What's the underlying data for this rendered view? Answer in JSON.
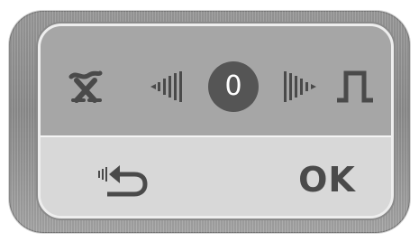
{
  "panel": {
    "top_row": {
      "left_icon": "x-tilde-icon",
      "decrease_icon": "volume-down-icon",
      "value": "0",
      "increase_icon": "volume-up-icon",
      "right_icon": "square-wave-icon"
    },
    "bottom_row": {
      "back_icon": "back-arrow-icon",
      "ok_label": "OK"
    }
  },
  "colors": {
    "bezel": "#8c8c8c",
    "top_row": "#a6a6a6",
    "bottom_row": "#d8d8d8",
    "icon": "#4a4a4a",
    "badge": "#555555",
    "badge_text": "#ffffff"
  }
}
